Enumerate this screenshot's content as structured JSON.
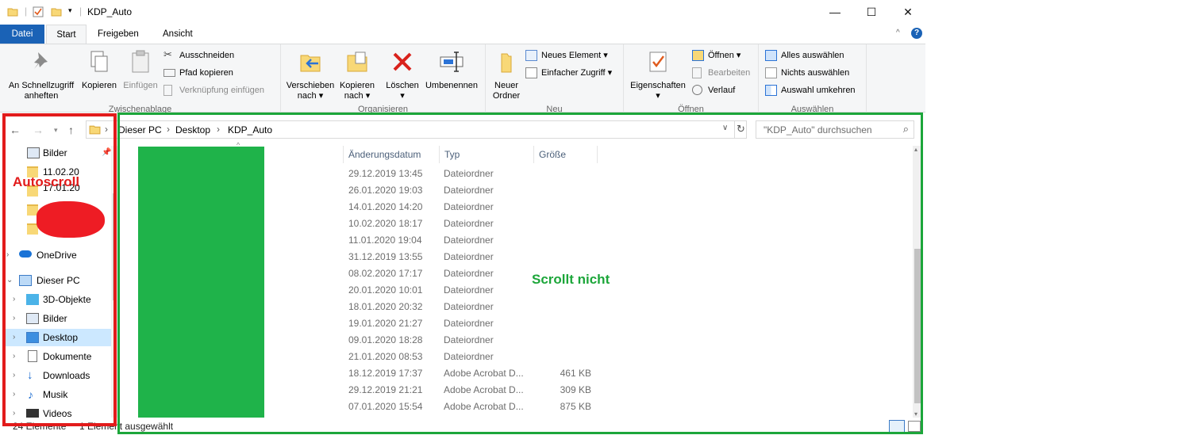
{
  "window": {
    "title": "KDP_Auto",
    "minimize_glyph": "—",
    "maximize_glyph": "☐",
    "close_glyph": "✕"
  },
  "tabs": [
    "Datei",
    "Start",
    "Freigeben",
    "Ansicht"
  ],
  "ribbon": {
    "clipboard": {
      "pin_label_1": "An Schnellzugriff",
      "pin_label_2": "anheften",
      "copy": "Kopieren",
      "paste": "Einfügen",
      "cut": "Ausschneiden",
      "copy_path": "Pfad kopieren",
      "paste_shortcut": "Verknüpfung einfügen",
      "group": "Zwischenablage"
    },
    "organize": {
      "move_1": "Verschieben",
      "move_2": "nach",
      "copy_to_1": "Kopieren",
      "copy_to_2": "nach",
      "delete": "Löschen",
      "rename": "Umbenennen",
      "group": "Organisieren"
    },
    "new": {
      "new_folder_1": "Neuer",
      "new_folder_2": "Ordner",
      "new_item": "Neues Element",
      "easy_access": "Einfacher Zugriff",
      "group": "Neu"
    },
    "open": {
      "properties": "Eigenschaften",
      "open": "Öffnen",
      "edit": "Bearbeiten",
      "history": "Verlauf",
      "group": "Öffnen"
    },
    "select": {
      "select_all": "Alles auswählen",
      "select_none": "Nichts auswählen",
      "invert": "Auswahl umkehren",
      "group": "Auswählen"
    }
  },
  "address": {
    "crumbs": [
      "Dieser PC",
      "Desktop",
      "KDP_Auto"
    ],
    "search_placeholder": "\"KDP_Auto\" durchsuchen"
  },
  "navpane": {
    "items": [
      {
        "label": "Bilder"
      },
      {
        "label": "11.02.20"
      },
      {
        "label": "17.01.20"
      },
      {
        "label": "OneDrive"
      },
      {
        "label": "Dieser PC"
      },
      {
        "label": "3D-Objekte"
      },
      {
        "label": "Bilder"
      },
      {
        "label": "Desktop"
      },
      {
        "label": "Dokumente"
      },
      {
        "label": "Downloads"
      },
      {
        "label": "Musik"
      },
      {
        "label": "Videos"
      }
    ]
  },
  "list": {
    "columns": [
      "Änderungsdatum",
      "Typ",
      "Größe"
    ],
    "rows": [
      {
        "date": "29.12.2019 13:45",
        "type": "Dateiordner",
        "size": ""
      },
      {
        "date": "26.01.2020 19:03",
        "type": "Dateiordner",
        "size": ""
      },
      {
        "date": "14.01.2020 14:20",
        "type": "Dateiordner",
        "size": ""
      },
      {
        "date": "10.02.2020 18:17",
        "type": "Dateiordner",
        "size": ""
      },
      {
        "date": "11.01.2020 19:04",
        "type": "Dateiordner",
        "size": ""
      },
      {
        "date": "31.12.2019 13:55",
        "type": "Dateiordner",
        "size": ""
      },
      {
        "date": "08.02.2020 17:17",
        "type": "Dateiordner",
        "size": ""
      },
      {
        "date": "20.01.2020 10:01",
        "type": "Dateiordner",
        "size": ""
      },
      {
        "date": "18.01.2020 20:32",
        "type": "Dateiordner",
        "size": ""
      },
      {
        "date": "19.01.2020 21:27",
        "type": "Dateiordner",
        "size": ""
      },
      {
        "date": "09.01.2020 18:28",
        "type": "Dateiordner",
        "size": ""
      },
      {
        "date": "21.01.2020 08:53",
        "type": "Dateiordner",
        "size": ""
      },
      {
        "date": "18.12.2019 17:37",
        "type": "Adobe Acrobat D...",
        "size": "461 KB"
      },
      {
        "date": "29.12.2019 21:21",
        "type": "Adobe Acrobat D...",
        "size": "309 KB"
      },
      {
        "date": "07.01.2020 15:54",
        "type": "Adobe Acrobat D...",
        "size": "875 KB"
      }
    ]
  },
  "status": {
    "count": "24 Elemente",
    "selected": "1 Element ausgewählt"
  },
  "annotations": {
    "left": "Autoscroll",
    "right": "Scrollt nicht",
    "left_color": "#e21b1b",
    "right_color": "#1ca63a"
  },
  "colors": {
    "file_tab": "#1a62b6",
    "selection": "#cce8ff",
    "redaction": "#1fb34a"
  }
}
